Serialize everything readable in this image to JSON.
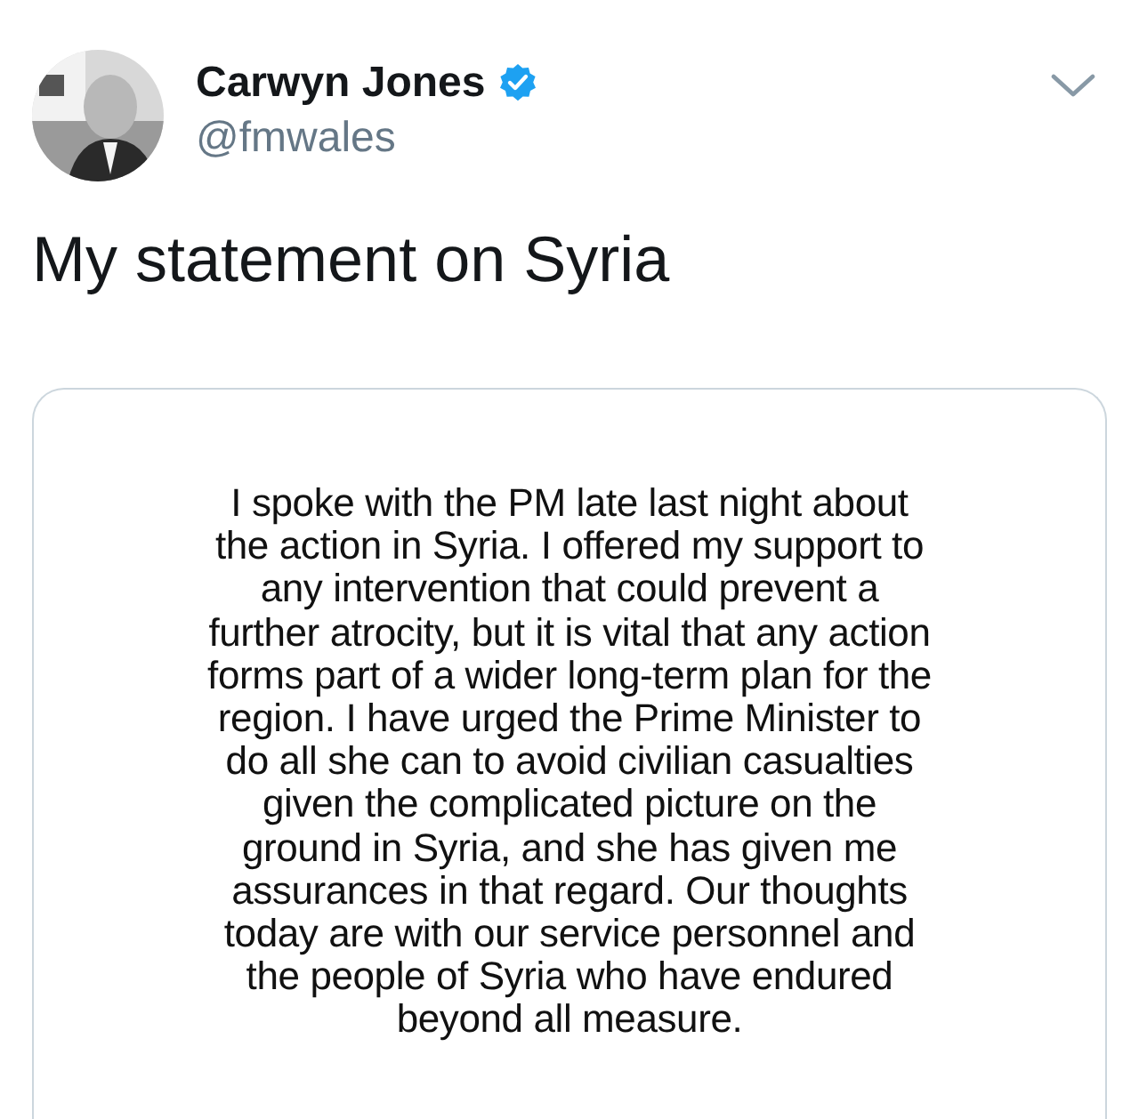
{
  "author": {
    "name": "Carwyn Jones",
    "verified": true,
    "handle": "@fmwales"
  },
  "tweet": {
    "text": "My statement on Syria"
  },
  "attachment": {
    "kind": "document",
    "lines": [
      "I spoke with the PM late last night about",
      "the action in Syria. I offered my support to",
      "any intervention that could prevent a",
      "further atrocity, but it is vital that any action",
      "forms part of a wider long-term plan for the",
      "region. I have urged the Prime Minister to",
      "do all she can to avoid civilian casualties",
      "given the complicated picture on the",
      "ground in Syria, and she has given me",
      "assurances in that regard. Our thoughts",
      "today are with our service personnel and",
      "the people of Syria who have endured",
      "beyond all measure."
    ]
  }
}
